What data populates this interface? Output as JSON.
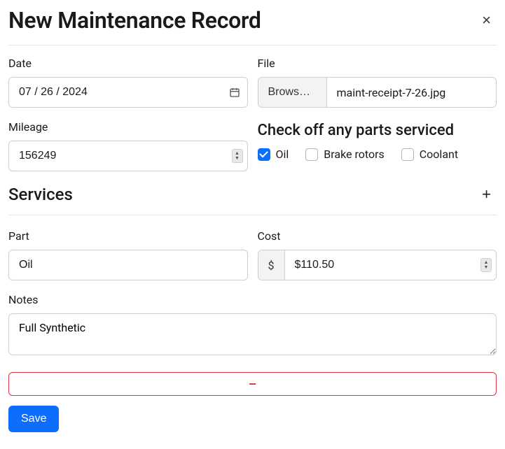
{
  "header": {
    "title": "New Maintenance Record",
    "close_glyph": "×"
  },
  "fields": {
    "date": {
      "label": "Date",
      "value": "07 / 26 / 2024"
    },
    "mileage": {
      "label": "Mileage",
      "value": "156249"
    },
    "file": {
      "label": "File",
      "browse_label": "Browse…",
      "filename": "maint-receipt-7-26.jpg"
    }
  },
  "parts_serviced": {
    "heading": "Check off any parts serviced",
    "items": [
      {
        "label": "Oil",
        "checked": true
      },
      {
        "label": "Brake rotors",
        "checked": false
      },
      {
        "label": "Coolant",
        "checked": false
      }
    ]
  },
  "services": {
    "heading": "Services",
    "add_glyph": "+",
    "entries": [
      {
        "part": {
          "label": "Part",
          "value": "Oil"
        },
        "cost": {
          "label": "Cost",
          "prefix": "$",
          "value": "$110.50"
        },
        "notes": {
          "label": "Notes",
          "value": "Full Synthetic"
        }
      }
    ],
    "delete_glyph": "−"
  },
  "actions": {
    "save_label": "Save"
  }
}
